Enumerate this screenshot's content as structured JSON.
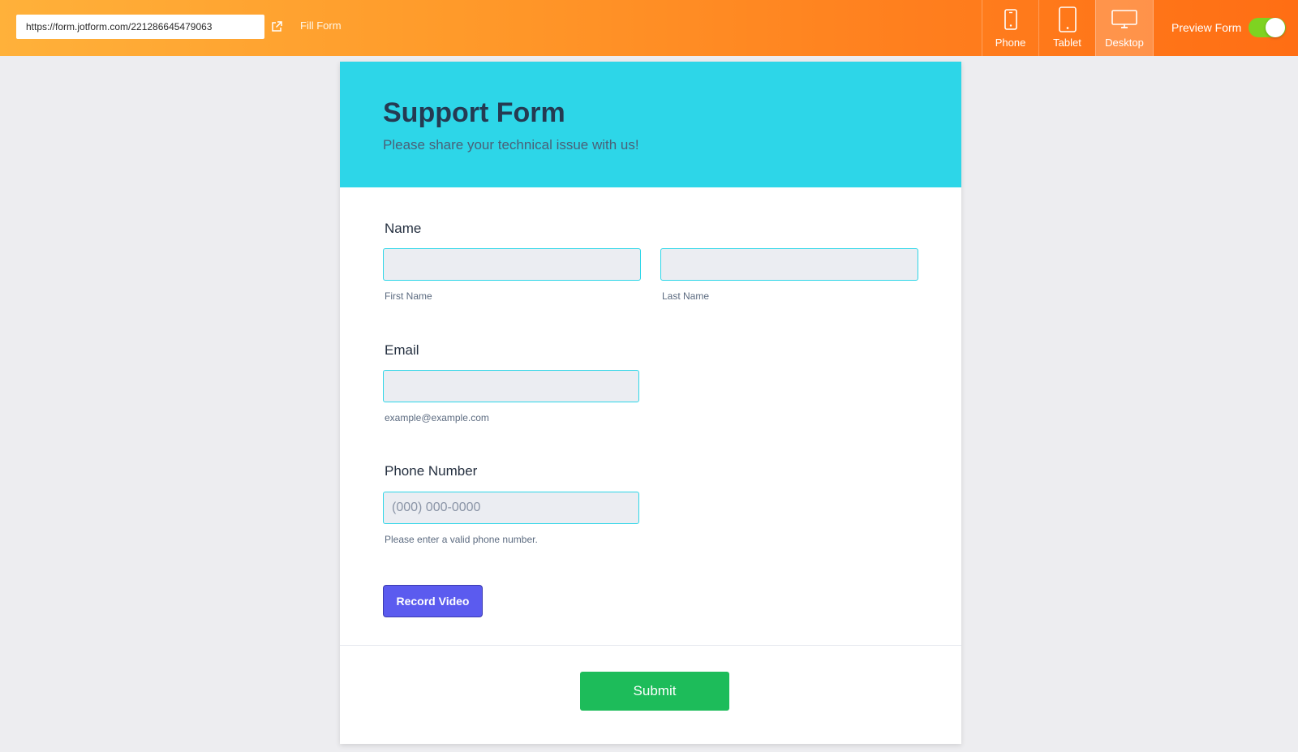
{
  "toolbar": {
    "url": "https://form.jotform.com/221286645479063",
    "fill_form": "Fill Form",
    "devices": [
      {
        "label": "Phone",
        "icon": "phone-icon",
        "active": false
      },
      {
        "label": "Tablet",
        "icon": "tablet-icon",
        "active": false
      },
      {
        "label": "Desktop",
        "icon": "desktop-icon",
        "active": true
      }
    ],
    "preview_label": "Preview Form",
    "preview_toggle_on": true,
    "toggle_color": "#7ed321"
  },
  "form": {
    "title": "Support Form",
    "subtitle": "Please share your technical issue with us!",
    "header_color": "#2dd6e8",
    "name": {
      "label": "Name",
      "first": {
        "value": "",
        "sublabel": "First Name"
      },
      "last": {
        "value": "",
        "sublabel": "Last Name"
      }
    },
    "email": {
      "label": "Email",
      "value": "",
      "sublabel": "example@example.com"
    },
    "phone": {
      "label": "Phone Number",
      "placeholder": "(000) 000-0000",
      "sublabel": "Please enter a valid phone number."
    },
    "record_video": "Record Video",
    "submit": "Submit",
    "submit_color": "#1dbc5a",
    "record_color": "#5b5bef"
  }
}
